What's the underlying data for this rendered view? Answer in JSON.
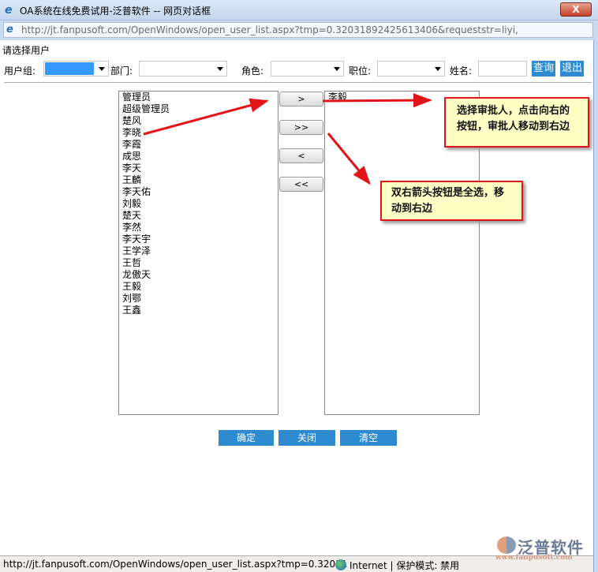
{
  "window": {
    "title": "OA系统在线免费试用-泛普软件 -- 网页对话框",
    "close": "X",
    "url": "http://jt.fanpusoft.com/OpenWindows/open_user_list.aspx?tmp=0.32031892425613406&requeststr=liyi,"
  },
  "prompt": "请选择用户",
  "filters": {
    "group_label": "用户组:",
    "dept_label": "部门:",
    "role_label": "角色:",
    "position_label": "职位:",
    "name_label": "姓名:",
    "name_value": "",
    "search": "查询",
    "exit": "退出"
  },
  "available_users": [
    "管理员",
    "超级管理员",
    "楚风",
    "李晓",
    "李霞",
    "成思",
    "李天",
    "王麟",
    "李天佑",
    "刘毅",
    "楚天",
    "李然",
    "李天宇",
    "王学泽",
    "王哲",
    "龙傲天",
    "王毅",
    "刘鄂",
    "王鑫"
  ],
  "selected_users": [
    "李毅"
  ],
  "move_buttons": {
    "add": ">",
    "add_all": ">>",
    "remove": "<",
    "remove_all": "<<"
  },
  "callouts": {
    "single": "选择审批人，点击向右的按钮，审批人移动到右边",
    "all": "双右箭头按钮是全选，移动到右边"
  },
  "actions": {
    "ok": "确定",
    "close": "关闭",
    "clear": "清空"
  },
  "status": {
    "url": "http://jt.fanpusoft.com/OpenWindows/open_user_list.aspx?tmp=0.32031",
    "zone": "Internet | 保护模式: 禁用"
  },
  "logo": {
    "name": "泛普软件",
    "site": "www.fanpusoft.com"
  }
}
